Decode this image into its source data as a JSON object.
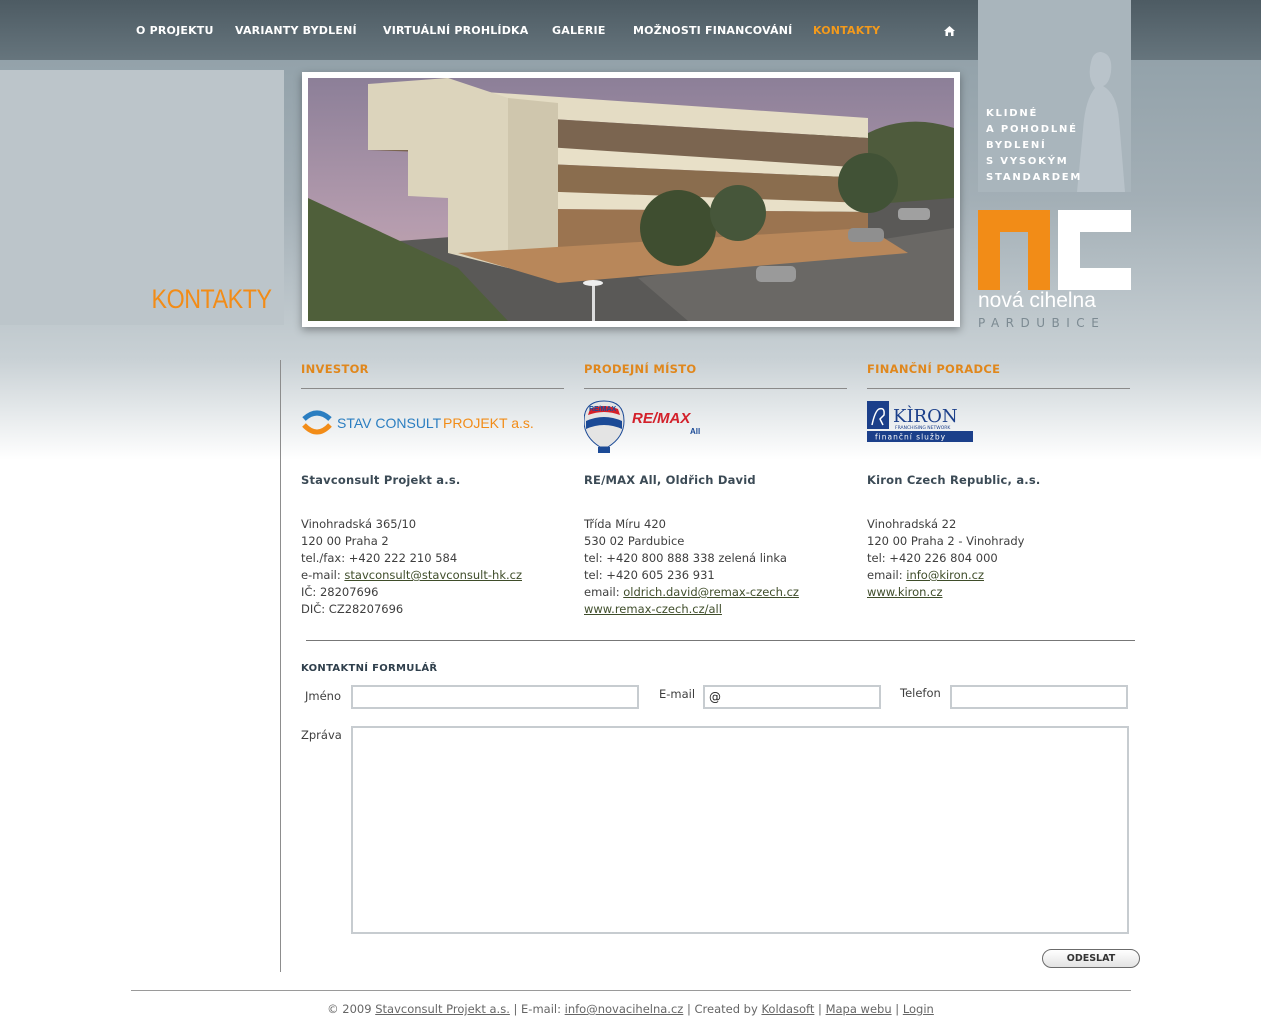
{
  "nav": {
    "items": [
      {
        "label": "O PROJEKTU"
      },
      {
        "label": "VARIANTY BYDLENÍ"
      },
      {
        "label": "VIRTUÁLNÍ PROHLÍDKA"
      },
      {
        "label": "GALERIE"
      },
      {
        "label": "MOŽNOSTI FINANCOVÁNÍ"
      },
      {
        "label": "KONTAKTY"
      }
    ],
    "active": "KONTAKTY",
    "home_icon": "home-icon"
  },
  "page_title": "KONTAKTY",
  "tagline": [
    "KLIDNÉ",
    "A POHODLNÉ",
    "BYDLENÍ",
    "S VYSOKÝM",
    "STANDARDEM"
  ],
  "logo": {
    "text": "nová cihelna",
    "subtext": "PARDUBICE"
  },
  "columns": [
    {
      "heading": "INVESTOR",
      "logo_text": [
        "STAV CONSULT ",
        "PROJEKT a.s."
      ],
      "company": "Stavconsult Projekt a.s.",
      "lines": [
        "Vinohradská 365/10",
        "120 00 Praha 2",
        "tel./fax: +420 222 210 584"
      ],
      "email_label": "e-mail: ",
      "email": "stavconsult@stavconsult-hk.cz",
      "extra": [
        "IČ: 28207696",
        "DIČ: CZ28207696"
      ]
    },
    {
      "heading": "PRODEJNÍ MÍSTO",
      "logo_text": [
        "RE/MAX",
        "RE/MAX",
        "All"
      ],
      "company": "RE/MAX All, Oldřich David",
      "lines": [
        "Třída Míru 420",
        "530 02 Pardubice",
        "tel: +420 800 888 338 zelená linka",
        "tel: +420 605 236 931"
      ],
      "email_label": "email: ",
      "email": "oldrich.david@remax-czech.cz",
      "web": "www.remax-czech.cz/all"
    },
    {
      "heading": "FINANČNÍ PORADCE",
      "logo_text": [
        "KÌRON",
        "FRANCHISING NETWORK",
        "finanční služby"
      ],
      "company": "Kiron Czech Republic, a.s.",
      "lines": [
        "Vinohradská 22",
        "120 00 Praha 2 - Vinohrady",
        "tel: +420 226 804 000"
      ],
      "email_label": "email: ",
      "email": "info@kiron.cz",
      "web": "www.kiron.cz"
    }
  ],
  "form": {
    "title": "KONTAKTNÍ FORMULÁŘ",
    "name_label": "Jméno",
    "email_label": "E-mail",
    "email_value": "@",
    "phone_label": "Telefon",
    "message_label": "Zpráva",
    "submit_label": "ODESLAT"
  },
  "footer": {
    "copyright": "© 2009 ",
    "company_link": "Stavconsult Projekt a.s.",
    "email_label": " | E-mail: ",
    "email_link": "info@novacihelna.cz",
    "created_by": " | Created by ",
    "creator_link": "Koldasoft",
    "sep1": " | ",
    "sitemap_link": "Mapa webu",
    "sep2": " | ",
    "login_link": "Login"
  },
  "colors": {
    "accent": "#f28c17",
    "nav_bg": "#55636b",
    "link": "#3f4d2a"
  }
}
